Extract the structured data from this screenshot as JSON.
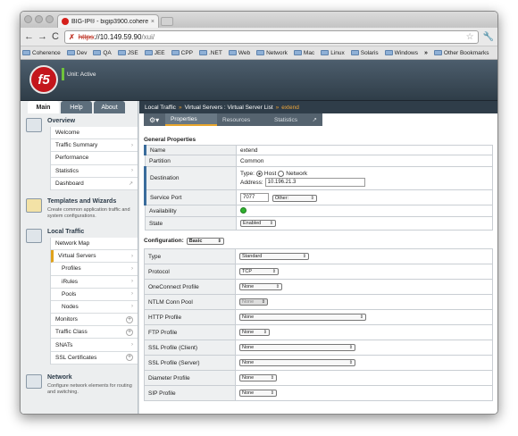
{
  "browser": {
    "tab_title": "BIG-IP® - bigip3900.cohere",
    "tab_close": "×",
    "url_scheme": "https",
    "url_host": "://10.149.59.90",
    "url_path": "/xui/",
    "bookmarks": [
      "Coherence",
      "Dev",
      "QA",
      "JSE",
      "JEE",
      "CPP",
      ".NET",
      "Web",
      "Network",
      "Mac",
      "Linux",
      "Solaris",
      "Windows"
    ],
    "more": "»",
    "other_bookmarks": "Other Bookmarks"
  },
  "header": {
    "logo": "f5",
    "status": "Unit: Active"
  },
  "left_tabs": [
    "Main",
    "Help",
    "About"
  ],
  "overview": {
    "title": "Overview",
    "items": [
      "Welcome",
      "Traffic Summary",
      "Performance",
      "Statistics",
      "Dashboard"
    ]
  },
  "templates": {
    "title": "Templates and Wizards",
    "desc": "Create common application traffic and system configurations."
  },
  "local_traffic": {
    "title": "Local Traffic",
    "items": [
      "Network Map",
      "Virtual Servers",
      "Profiles",
      "iRules",
      "Pools",
      "Nodes",
      "Monitors",
      "Traffic Class",
      "SNATs",
      "SSL Certificates"
    ]
  },
  "network": {
    "title": "Network",
    "desc": "Configure network elements for routing and switching."
  },
  "breadcrumb": {
    "part1": "Local Traffic",
    "sep": "»",
    "part2": "Virtual Servers : Virtual Server List",
    "current": "extend"
  },
  "page_tabs": [
    "Properties",
    "Resources",
    "Statistics"
  ],
  "general": {
    "title": "General Properties",
    "name_label": "Name",
    "name_value": "extend",
    "partition_label": "Partition",
    "partition_value": "Common",
    "destination_label": "Destination",
    "type_label": "Type:",
    "host_label": "Host",
    "network_label": "Network",
    "address_label": "Address:",
    "address_value": "10.196.21.3",
    "port_label": "Service Port",
    "port_value": "7077",
    "port_select": "Other:",
    "availability_label": "Availability",
    "state_label": "State",
    "state_value": "Enabled"
  },
  "configuration": {
    "title": "Configuration:",
    "mode": "Basic",
    "rows": [
      {
        "label": "Type",
        "value": "Standard"
      },
      {
        "label": "Protocol",
        "value": "TCP"
      },
      {
        "label": "OneConnect Profile",
        "value": "None"
      },
      {
        "label": "NTLM Conn Pool",
        "value": "None"
      },
      {
        "label": "HTTP Profile",
        "value": "None"
      },
      {
        "label": "FTP Profile",
        "value": "None"
      },
      {
        "label": "SSL Profile (Client)",
        "value": "None"
      },
      {
        "label": "SSL Profile (Server)",
        "value": "None"
      },
      {
        "label": "Diameter Profile",
        "value": "None"
      },
      {
        "label": "SIP Profile",
        "value": "None"
      }
    ]
  },
  "colors": {
    "accent": "#e8a52b",
    "f5_red": "#c4161c",
    "status_green": "#2fb12f"
  }
}
